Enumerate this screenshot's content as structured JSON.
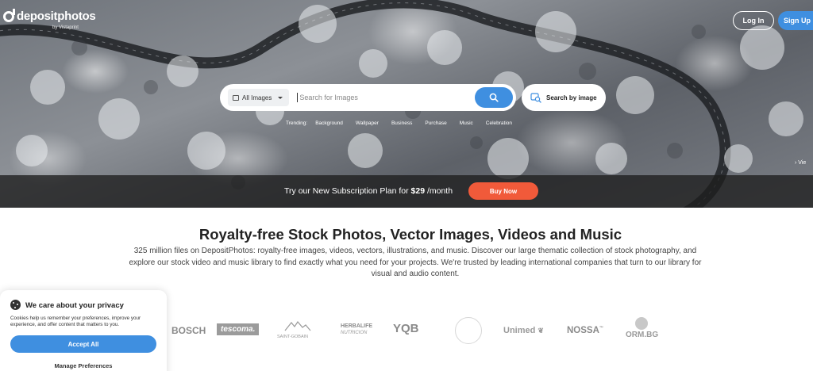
{
  "header": {
    "logo_text": "depositphotos",
    "logo_sub": "by Vistaprint",
    "login_label": "Log In",
    "signup_label": "Sign Up"
  },
  "search": {
    "type_label": "All Images",
    "placeholder": "Search for Images",
    "by_image_label": "Search by image"
  },
  "trending": {
    "label": "Trending:",
    "items": [
      "Background",
      "Wallpaper",
      "Business",
      "Purchase",
      "Music",
      "Celebration"
    ]
  },
  "hero": {
    "view_label": "Vie"
  },
  "promo": {
    "text_prefix": "Try our New Subscription Plan for",
    "price": "$29",
    "text_suffix": "/month",
    "button_label": "Buy Now"
  },
  "info": {
    "headline": "Royalty-free Stock Photos, Vector Images, Videos and Music",
    "description": "325 million files on DepositPhotos: royalty-free images, videos, vectors, illustrations, and music. Discover our large thematic collection of stock photography, and explore our stock video and music library to find exactly what you need for your projects. We're trusted by leading international companies that turn to our library for visual and audio content."
  },
  "brands": [
    "BOSCH",
    "tescoma.",
    "SAINT-GOBAIN",
    "HERBALIFE",
    "NUTRICION",
    "YQB",
    "Unimed",
    "NOSSA",
    "ORM.BG"
  ],
  "cookie": {
    "title": "We care about your privacy",
    "text": "Cookies help us remember your preferences, improve your experience, and offer content that matters to you.",
    "accept_label": "Accept All",
    "manage_label": "Manage Preferences"
  },
  "colors": {
    "accent": "#3f8fe0",
    "buy": "#f15a3a",
    "promo_bar": "#1e1e1e"
  }
}
